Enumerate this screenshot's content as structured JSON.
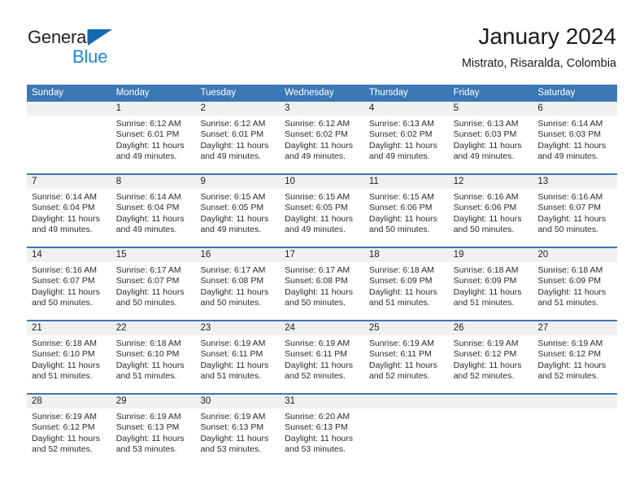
{
  "brand": {
    "name_part1": "General",
    "name_part2": "Blue",
    "colors": {
      "general": "#231f20",
      "blue": "#1c8ad4",
      "triangle": "#1269b0"
    }
  },
  "header": {
    "title": "January 2024",
    "subtitle": "Mistrato, Risaralda, Colombia"
  },
  "theme": {
    "header_bg": "#3c78b4",
    "header_text": "#ffffff",
    "day_band_bg": "#f0f0f0",
    "cell_bg": "#ffffff"
  },
  "calendar": {
    "weekday_headers": [
      "Sunday",
      "Monday",
      "Tuesday",
      "Wednesday",
      "Thursday",
      "Friday",
      "Saturday"
    ],
    "weeks": [
      [
        {
          "day": "",
          "empty": true,
          "sunrise": "",
          "sunset": "",
          "daylight_line1": "",
          "daylight_line2": ""
        },
        {
          "day": "1",
          "empty": false,
          "sunrise": "Sunrise: 6:12 AM",
          "sunset": "Sunset: 6:01 PM",
          "daylight_line1": "Daylight: 11 hours",
          "daylight_line2": "and 49 minutes."
        },
        {
          "day": "2",
          "empty": false,
          "sunrise": "Sunrise: 6:12 AM",
          "sunset": "Sunset: 6:01 PM",
          "daylight_line1": "Daylight: 11 hours",
          "daylight_line2": "and 49 minutes."
        },
        {
          "day": "3",
          "empty": false,
          "sunrise": "Sunrise: 6:12 AM",
          "sunset": "Sunset: 6:02 PM",
          "daylight_line1": "Daylight: 11 hours",
          "daylight_line2": "and 49 minutes."
        },
        {
          "day": "4",
          "empty": false,
          "sunrise": "Sunrise: 6:13 AM",
          "sunset": "Sunset: 6:02 PM",
          "daylight_line1": "Daylight: 11 hours",
          "daylight_line2": "and 49 minutes."
        },
        {
          "day": "5",
          "empty": false,
          "sunrise": "Sunrise: 6:13 AM",
          "sunset": "Sunset: 6:03 PM",
          "daylight_line1": "Daylight: 11 hours",
          "daylight_line2": "and 49 minutes."
        },
        {
          "day": "6",
          "empty": false,
          "sunrise": "Sunrise: 6:14 AM",
          "sunset": "Sunset: 6:03 PM",
          "daylight_line1": "Daylight: 11 hours",
          "daylight_line2": "and 49 minutes."
        }
      ],
      [
        {
          "day": "7",
          "empty": false,
          "sunrise": "Sunrise: 6:14 AM",
          "sunset": "Sunset: 6:04 PM",
          "daylight_line1": "Daylight: 11 hours",
          "daylight_line2": "and 49 minutes."
        },
        {
          "day": "8",
          "empty": false,
          "sunrise": "Sunrise: 6:14 AM",
          "sunset": "Sunset: 6:04 PM",
          "daylight_line1": "Daylight: 11 hours",
          "daylight_line2": "and 49 minutes."
        },
        {
          "day": "9",
          "empty": false,
          "sunrise": "Sunrise: 6:15 AM",
          "sunset": "Sunset: 6:05 PM",
          "daylight_line1": "Daylight: 11 hours",
          "daylight_line2": "and 49 minutes."
        },
        {
          "day": "10",
          "empty": false,
          "sunrise": "Sunrise: 6:15 AM",
          "sunset": "Sunset: 6:05 PM",
          "daylight_line1": "Daylight: 11 hours",
          "daylight_line2": "and 49 minutes."
        },
        {
          "day": "11",
          "empty": false,
          "sunrise": "Sunrise: 6:15 AM",
          "sunset": "Sunset: 6:06 PM",
          "daylight_line1": "Daylight: 11 hours",
          "daylight_line2": "and 50 minutes."
        },
        {
          "day": "12",
          "empty": false,
          "sunrise": "Sunrise: 6:16 AM",
          "sunset": "Sunset: 6:06 PM",
          "daylight_line1": "Daylight: 11 hours",
          "daylight_line2": "and 50 minutes."
        },
        {
          "day": "13",
          "empty": false,
          "sunrise": "Sunrise: 6:16 AM",
          "sunset": "Sunset: 6:07 PM",
          "daylight_line1": "Daylight: 11 hours",
          "daylight_line2": "and 50 minutes."
        }
      ],
      [
        {
          "day": "14",
          "empty": false,
          "sunrise": "Sunrise: 6:16 AM",
          "sunset": "Sunset: 6:07 PM",
          "daylight_line1": "Daylight: 11 hours",
          "daylight_line2": "and 50 minutes."
        },
        {
          "day": "15",
          "empty": false,
          "sunrise": "Sunrise: 6:17 AM",
          "sunset": "Sunset: 6:07 PM",
          "daylight_line1": "Daylight: 11 hours",
          "daylight_line2": "and 50 minutes."
        },
        {
          "day": "16",
          "empty": false,
          "sunrise": "Sunrise: 6:17 AM",
          "sunset": "Sunset: 6:08 PM",
          "daylight_line1": "Daylight: 11 hours",
          "daylight_line2": "and 50 minutes."
        },
        {
          "day": "17",
          "empty": false,
          "sunrise": "Sunrise: 6:17 AM",
          "sunset": "Sunset: 6:08 PM",
          "daylight_line1": "Daylight: 11 hours",
          "daylight_line2": "and 50 minutes."
        },
        {
          "day": "18",
          "empty": false,
          "sunrise": "Sunrise: 6:18 AM",
          "sunset": "Sunset: 6:09 PM",
          "daylight_line1": "Daylight: 11 hours",
          "daylight_line2": "and 51 minutes."
        },
        {
          "day": "19",
          "empty": false,
          "sunrise": "Sunrise: 6:18 AM",
          "sunset": "Sunset: 6:09 PM",
          "daylight_line1": "Daylight: 11 hours",
          "daylight_line2": "and 51 minutes."
        },
        {
          "day": "20",
          "empty": false,
          "sunrise": "Sunrise: 6:18 AM",
          "sunset": "Sunset: 6:09 PM",
          "daylight_line1": "Daylight: 11 hours",
          "daylight_line2": "and 51 minutes."
        }
      ],
      [
        {
          "day": "21",
          "empty": false,
          "sunrise": "Sunrise: 6:18 AM",
          "sunset": "Sunset: 6:10 PM",
          "daylight_line1": "Daylight: 11 hours",
          "daylight_line2": "and 51 minutes."
        },
        {
          "day": "22",
          "empty": false,
          "sunrise": "Sunrise: 6:18 AM",
          "sunset": "Sunset: 6:10 PM",
          "daylight_line1": "Daylight: 11 hours",
          "daylight_line2": "and 51 minutes."
        },
        {
          "day": "23",
          "empty": false,
          "sunrise": "Sunrise: 6:19 AM",
          "sunset": "Sunset: 6:11 PM",
          "daylight_line1": "Daylight: 11 hours",
          "daylight_line2": "and 51 minutes."
        },
        {
          "day": "24",
          "empty": false,
          "sunrise": "Sunrise: 6:19 AM",
          "sunset": "Sunset: 6:11 PM",
          "daylight_line1": "Daylight: 11 hours",
          "daylight_line2": "and 52 minutes."
        },
        {
          "day": "25",
          "empty": false,
          "sunrise": "Sunrise: 6:19 AM",
          "sunset": "Sunset: 6:11 PM",
          "daylight_line1": "Daylight: 11 hours",
          "daylight_line2": "and 52 minutes."
        },
        {
          "day": "26",
          "empty": false,
          "sunrise": "Sunrise: 6:19 AM",
          "sunset": "Sunset: 6:12 PM",
          "daylight_line1": "Daylight: 11 hours",
          "daylight_line2": "and 52 minutes."
        },
        {
          "day": "27",
          "empty": false,
          "sunrise": "Sunrise: 6:19 AM",
          "sunset": "Sunset: 6:12 PM",
          "daylight_line1": "Daylight: 11 hours",
          "daylight_line2": "and 52 minutes."
        }
      ],
      [
        {
          "day": "28",
          "empty": false,
          "sunrise": "Sunrise: 6:19 AM",
          "sunset": "Sunset: 6:12 PM",
          "daylight_line1": "Daylight: 11 hours",
          "daylight_line2": "and 52 minutes."
        },
        {
          "day": "29",
          "empty": false,
          "sunrise": "Sunrise: 6:19 AM",
          "sunset": "Sunset: 6:13 PM",
          "daylight_line1": "Daylight: 11 hours",
          "daylight_line2": "and 53 minutes."
        },
        {
          "day": "30",
          "empty": false,
          "sunrise": "Sunrise: 6:19 AM",
          "sunset": "Sunset: 6:13 PM",
          "daylight_line1": "Daylight: 11 hours",
          "daylight_line2": "and 53 minutes."
        },
        {
          "day": "31",
          "empty": false,
          "sunrise": "Sunrise: 6:20 AM",
          "sunset": "Sunset: 6:13 PM",
          "daylight_line1": "Daylight: 11 hours",
          "daylight_line2": "and 53 minutes."
        },
        {
          "day": "",
          "empty": true,
          "sunrise": "",
          "sunset": "",
          "daylight_line1": "",
          "daylight_line2": ""
        },
        {
          "day": "",
          "empty": true,
          "sunrise": "",
          "sunset": "",
          "daylight_line1": "",
          "daylight_line2": ""
        },
        {
          "day": "",
          "empty": true,
          "sunrise": "",
          "sunset": "",
          "daylight_line1": "",
          "daylight_line2": ""
        }
      ]
    ]
  }
}
